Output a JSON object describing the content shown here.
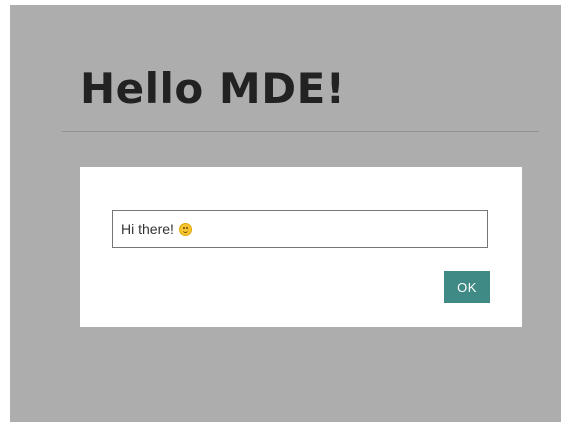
{
  "page": {
    "title": "Hello MDE!"
  },
  "dialog": {
    "input_value": "Hi there!",
    "emoji_icon": "slightly-smiling-face-icon",
    "ok_label": "OK"
  },
  "colors": {
    "overlay": "#adadad",
    "button": "#3f8a85",
    "title_text": "#333333"
  }
}
